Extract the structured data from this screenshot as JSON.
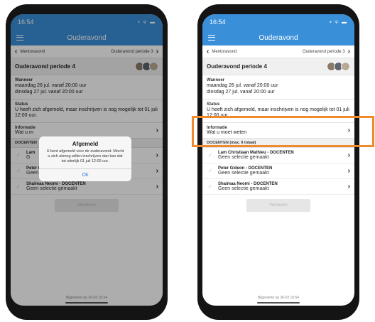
{
  "status_bar": {
    "time": "16:54",
    "icons": "▪ ᯤ ▬"
  },
  "app_bar": {
    "title": "Ouderavond"
  },
  "nav": {
    "prev": "Mentoravond",
    "next": "Ouderavond periode 3"
  },
  "event": {
    "title": "Ouderavond periode 4"
  },
  "when": {
    "label": "Wanneer",
    "line1": "maandag 26 jul. vanaf 20:00 uur",
    "line2": "dinsdag 27 jul. vanaf 20:00 uur"
  },
  "status": {
    "label": "Status",
    "text": "U heeft zich afgemeld, maar inschrijven is nog mogelijk tot 01 juli 12:00 uur."
  },
  "info": {
    "label": "Informatie",
    "text": "Wat u moet weten"
  },
  "teachers": {
    "section_label": "DOCENTEN (max. 9 totaal)",
    "left_section_label": "DOCENTEN",
    "items": [
      {
        "name": "Lam Christiaan Mathieu - DOCENTEN",
        "selection": "Geen selectie gemaakt"
      },
      {
        "name": "Peter Gideon - DOCENTEN",
        "selection": "Geen selectie gemaakt"
      },
      {
        "name": "Shaimaa Neomi - DOCENTEN",
        "selection": "Geen selectie gemaakt"
      }
    ]
  },
  "left_partial": {
    "info_label": "Informatie",
    "info_text": "Wat u m",
    "teacher1_name": "Lam",
    "teacher1_sel": "G"
  },
  "submit": {
    "label": "Versturen"
  },
  "footer": {
    "updated": "Bijgewerkt op 30-03 16:54"
  },
  "dialog": {
    "title": "Afgemeld",
    "message": "U bent afgemeld voor de ouderavond. Mocht u zich alsnog willen inschrijven dan kan dat tot uiterlijk 01 juli 12:00 uur.",
    "ok": "Ok"
  },
  "colors": {
    "primary": "#3a8fd9",
    "highlight": "#f08a2c",
    "link": "#2b7bd0"
  }
}
